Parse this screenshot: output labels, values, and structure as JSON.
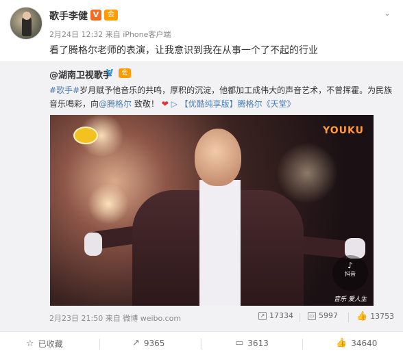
{
  "post": {
    "author": "歌手李健",
    "verify_badge": "V",
    "member_badge": "会",
    "time": "2月24日 12:32",
    "source_prefix": "来自",
    "source": "iPhone客户端",
    "text": "看了腾格尔老师的表演，让我意识到我在从事一个了不起的行业",
    "menu_icon": "chevron-down-icon"
  },
  "repost": {
    "author": "@湖南卫视歌手",
    "verify_badge": "V",
    "member_badge": "会",
    "hashtag": "#歌手#",
    "line1_text": "岁月赋予他音乐的共鸣，厚积的沉淀，他都加工成伟大的声音艺术，不曾挥霍。为民族",
    "line2_prefix": "音乐喝彩，向",
    "mention": "@腾格尔",
    "line2_middle": " 致敬！",
    "heart": "❤",
    "video_tag": "【优酷纯享版】腾格尔《天堂》",
    "video_logo": "YOUKU",
    "douyin_label": "抖音",
    "douyin_slogan": "音乐 爱人生",
    "time": "2月23日 21:50",
    "source_prefix": "来自",
    "source": "微博 weibo.com",
    "reposts": "17334",
    "comments": "5997",
    "likes": "13753"
  },
  "actions": {
    "favorite": "已收藏",
    "reposts": "9365",
    "comments": "3613",
    "likes": "34640"
  },
  "colors": {
    "link": "#4a7fb5",
    "badge_orange": "#f26d22",
    "verify_blue": "#2a9ee0"
  }
}
